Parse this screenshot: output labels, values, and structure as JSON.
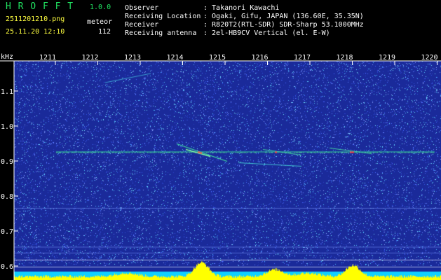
{
  "header": {
    "app_name": "H R O F F T",
    "version": "1.0.0",
    "filename": "2511201210.png",
    "datetime": "25.11.20 12:10",
    "event_label": "meteor",
    "event_count": "112",
    "fields": [
      {
        "label": "Observer",
        "value": ": Takanori Kawachi"
      },
      {
        "label": "Receiving Location",
        "value": ": Ogaki, Gifu, JAPAN (136.60E, 35.35N)"
      },
      {
        "label": "Receiver",
        "value": ": R820T2(RTL-SDR) SDR-Sharp 53.1000MHz"
      },
      {
        "label": "Receiving antenna",
        "value": ": 2el-HB9CV Vertical (el. E-W)"
      }
    ]
  },
  "plot": {
    "y_unit": "kHz",
    "y_ticks": [
      "1.1",
      "1.0",
      "0.9",
      "0.8",
      "0.7",
      "0.6"
    ],
    "x_ticks": [
      "1211",
      "1212",
      "1213",
      "1214",
      "1215",
      "1216",
      "1217",
      "1218",
      "1219",
      "1220"
    ]
  },
  "chart_data": {
    "type": "heatmap",
    "xlabel": "",
    "ylabel": "kHz",
    "x_ticks": [
      "1211",
      "1212",
      "1213",
      "1214",
      "1215",
      "1216",
      "1217",
      "1218",
      "1219",
      "1220"
    ],
    "ylim": [
      0.58,
      1.2
    ],
    "y_ticks": [
      1.1,
      1.0,
      0.9,
      0.8,
      0.7,
      0.6
    ],
    "carrier_khz": 0.925,
    "colors": {
      "background": "#1a2a9a",
      "noise": "#4060ff",
      "signal": "#40ff80",
      "peak": "#ff4040",
      "bottom_bar": "#ffff00",
      "bottom_band": "#00ffff"
    }
  }
}
